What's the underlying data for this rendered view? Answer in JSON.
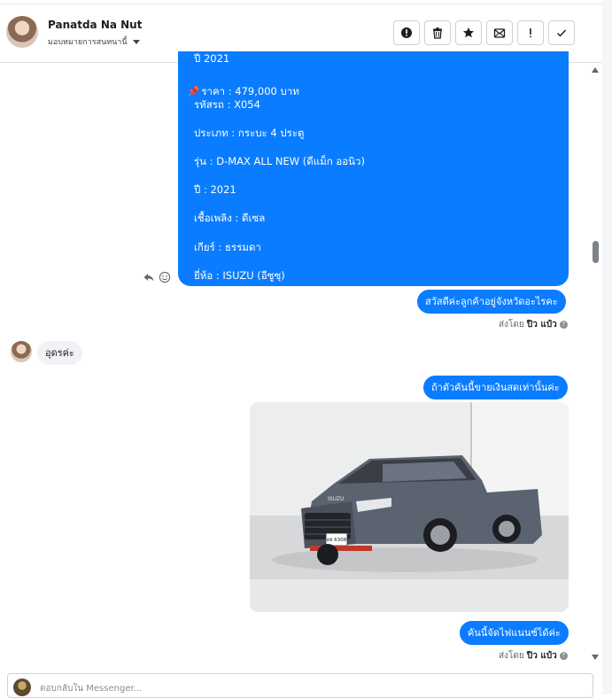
{
  "header": {
    "contact_name": "Panatda Na Nut",
    "assign_label": "มอบหมายการสนทนานี้",
    "actions": [
      {
        "name": "report-spam-icon"
      },
      {
        "name": "trash-icon"
      },
      {
        "name": "star-icon"
      },
      {
        "name": "mark-unread-icon"
      },
      {
        "name": "important-icon"
      },
      {
        "name": "done-check-icon"
      }
    ]
  },
  "listing": {
    "top_partial": "ปี 2021",
    "price": "ราคา : 479,000 บาท",
    "code": "รหัสรถ : X054",
    "type": "ประเภท : กระบะ 4 ประตู",
    "model": "รุ่น : D-MAX ALL NEW (ดีแม็ก ออนิว)",
    "year": "ปี : 2021",
    "fuel": "เชื้อเพลิง : ดีเซล",
    "gear": "เกียร์ : ธรรมดา",
    "brand": "ยี่ห้อ : ISUZU (อีซูซุ)"
  },
  "messages": {
    "out1": "สวัสดีค่ะลูกค้าอยู่จังหวัดอะไรคะ",
    "in1": "อุดรค่ะ",
    "out2": "ถ้าตัวคันนี้ขายเงินสดเท่านั้นค่ะ",
    "out3": "คันนี้จัดไฟแนนซ์ได้ค่ะ",
    "sent_by_prefix": "ส่งโดย",
    "sent_by_name": "ปิว แป๋ว",
    "help_glyph": "?"
  },
  "photo": {
    "plate_top": "ยห 6308",
    "brand_badge": "ISUZU"
  },
  "composer": {
    "placeholder": "ตอบกลับใน Messenger..."
  },
  "colors": {
    "bubble_out": "#0a7cff",
    "bubble_in": "#f0f2f5"
  }
}
